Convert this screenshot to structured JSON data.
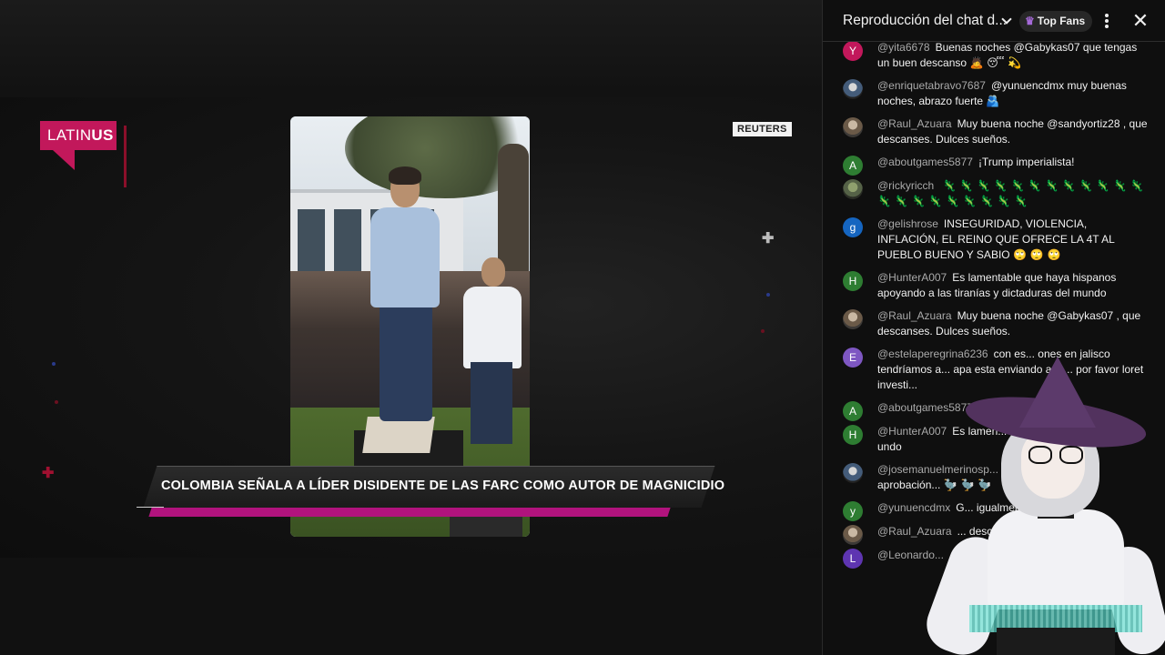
{
  "video": {
    "logo": {
      "part1": "LATIN",
      "part2": "US"
    },
    "watermark": "REUTERS",
    "headline": "COLOMBIA SEÑALA A LÍDER DISIDENTE DE LAS FARC COMO AUTOR DE MAGNICIDIO",
    "colors": {
      "brand": "#c2185b",
      "ticker_bar": "#b1137d"
    }
  },
  "chat": {
    "title": "Reproducción del chat d...",
    "filter_label": "Top Fans",
    "icons": {
      "filter": "crown-icon",
      "dropdown": "chevron-down-icon",
      "menu": "more-vert-icon",
      "close": "close-icon"
    },
    "messages": [
      {
        "initial": "Y",
        "avatar_color": "#c2185b",
        "author": "@yita6678",
        "text": "Buenas noches @Gabykas07 que tengas un buen descanso",
        "emoji": "🙇 😴 💫"
      },
      {
        "initial": "",
        "avatar_color": "img2",
        "author": "@enriquetabravo7687",
        "text": "@yunuencdmx muy buenas noches, abrazo fuerte",
        "emoji": "🫂"
      },
      {
        "initial": "",
        "avatar_color": "img",
        "author": "@Raul_Azuara",
        "text": "Muy buena noche @sandyortiz28 , que descanses. Dulces sueños.",
        "emoji": ""
      },
      {
        "initial": "A",
        "avatar_color": "#2e7d32",
        "author": "@aboutgames5877",
        "text": "¡Trump imperialista!",
        "emoji": ""
      },
      {
        "initial": "",
        "avatar_color": "img3",
        "author": "@rickyricch",
        "text": "",
        "emoji": "🦎 🦎 🦎 🦎 🦎 🦎 🦎 🦎 🦎 🦎 🦎 🦎 🦎 🦎 🦎 🦎 🦎 🦎 🦎 🦎 🦎"
      },
      {
        "initial": "g",
        "avatar_color": "#1565c0",
        "author": "@gelishrose",
        "text": "INSEGURIDAD, VIOLENCIA, INFLACIÓN, EL REINO QUE OFRECE LA 4T AL PUEBLO BUENO Y SABIO",
        "emoji": "🙄 🙄 🙄"
      },
      {
        "initial": "H",
        "avatar_color": "#2e7d32",
        "author": "@HunterA007",
        "text": "Es lamentable que haya hispanos apoyando a las tiranías y dictaduras del mundo",
        "emoji": ""
      },
      {
        "initial": "",
        "avatar_color": "img",
        "author": "@Raul_Azuara",
        "text": "Muy buena noche @Gabykas07 , que descanses. Dulces sueños.",
        "emoji": ""
      },
      {
        "initial": "E",
        "avatar_color": "#7e57c2",
        "author": "@estelaperegrina6236",
        "text": "con es... ones en jalisco tendríamos a... apa esta enviando agu... por favor loret investi...",
        "emoji": ""
      },
      {
        "initial": "A",
        "avatar_color": "#2e7d32",
        "author": "@aboutgames5877",
        "text": "¡Trum...",
        "emoji": ""
      },
      {
        "initial": "H",
        "avatar_color": "#2e7d32",
        "author": "@HunterA007",
        "text": "Es lamen... apoyando a las tiranías y... undo",
        "emoji": ""
      },
      {
        "initial": "",
        "avatar_color": "img2",
        "author": "@josemanuelmerinosp...",
        "text": "...h, ya tiene más aprobación...",
        "emoji": "🦤 🦤 🦤"
      },
      {
        "initial": "y",
        "avatar_color": "#2e7d32",
        "author": "@yunuencdmx",
        "text": "G... igualmente, bue...",
        "emoji": ""
      },
      {
        "initial": "",
        "avatar_color": "img",
        "author": "@Raul_Azuara",
        "text": "... descanses. ...",
        "emoji": ""
      },
      {
        "initial": "L",
        "avatar_color": "#5e35b1",
        "author": "@Leonardo...",
        "text": "...Ca...",
        "emoji": ""
      }
    ]
  }
}
